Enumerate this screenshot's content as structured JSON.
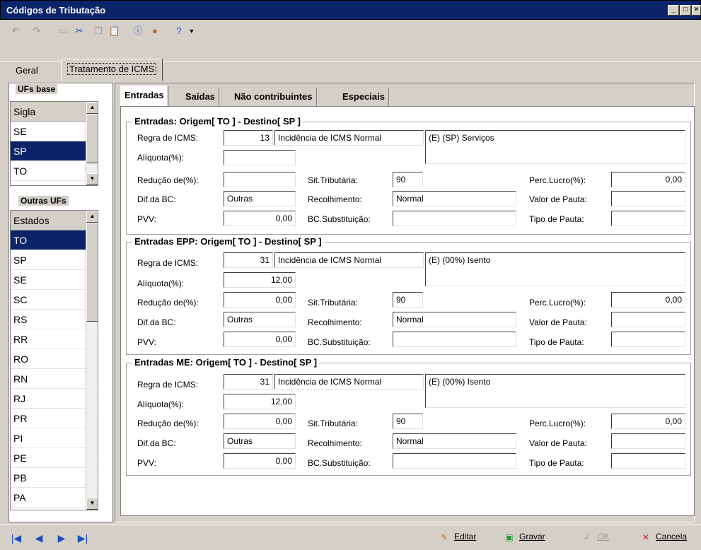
{
  "window": {
    "title": "Códigos de Tributação"
  },
  "toolbar": {
    "icons": [
      "undo-icon",
      "redo-icon",
      "new-icon",
      "cut-icon",
      "copy-icon",
      "paste-icon",
      "info-icon",
      "user-icon",
      "help-icon",
      "dropdown-arrow-icon"
    ]
  },
  "tabs": {
    "general": "Geral",
    "icms": "Tratamento de ICMS"
  },
  "ufs_base": {
    "title": "UFs base",
    "header": "Sigla",
    "items": [
      "SE",
      "SP",
      "TO"
    ],
    "selected": "SP"
  },
  "outras_ufs": {
    "title": "Outras UFs",
    "header": "Estados",
    "items": [
      "TO",
      "SP",
      "SE",
      "SC",
      "RS",
      "RR",
      "RO",
      "RN",
      "RJ",
      "PR",
      "PI",
      "PE",
      "PB",
      "PA"
    ],
    "selected": "TO"
  },
  "inner_tabs": [
    "Entradas",
    "Saídas",
    "Não contribuintes",
    "Especiais"
  ],
  "labels": {
    "regra": "Regra de ICMS:",
    "aliquota": "Alíquota(%):",
    "reducao": "Redução de(%):",
    "dif_bc": "Dif.da BC:",
    "pvv": "PVV:",
    "sit_trib": "Sit.Tributária:",
    "recolhimento": "Recolhimento:",
    "bc_subst": "BC.Substituição:",
    "perc_lucro": "Perc.Lucro(%):",
    "valor_pauta": "Valor de Pauta:",
    "tipo_pauta": "Tipo de Pauta:"
  },
  "sections": [
    {
      "title": "Entradas: Origem[ TO ] - Destino[ SP ]",
      "regra_code": "13",
      "regra_desc": "Incidência de ICMS Normal",
      "regra_note": "(E) (SP) Serviços",
      "aliquota": "",
      "reducao": "",
      "dif_bc": "Outras",
      "pvv": "0,00",
      "sit_trib": "90",
      "recolhimento": "Normal",
      "bc_subst": "",
      "perc_lucro": "0,00",
      "valor_pauta": "",
      "tipo_pauta": ""
    },
    {
      "title": "Entradas EPP: Origem[ TO ] - Destino[ SP ]",
      "regra_code": "31",
      "regra_desc": "Incidência de ICMS Normal",
      "regra_note": "(E) (00%) Isento",
      "aliquota": "12,00",
      "reducao": "0,00",
      "dif_bc": "Outras",
      "pvv": "0,00",
      "sit_trib": "90",
      "recolhimento": "Normal",
      "bc_subst": "",
      "perc_lucro": "0,00",
      "valor_pauta": "",
      "tipo_pauta": ""
    },
    {
      "title": "Entradas ME: Origem[ TO ] - Destino[ SP ]",
      "regra_code": "31",
      "regra_desc": "Incidência de ICMS Normal",
      "regra_note": "(E) (00%) Isento",
      "aliquota": "12,00",
      "reducao": "0,00",
      "dif_bc": "Outras",
      "pvv": "0,00",
      "sit_trib": "90",
      "recolhimento": "Normal",
      "bc_subst": "",
      "perc_lucro": "0,00",
      "valor_pauta": "",
      "tipo_pauta": ""
    }
  ],
  "actions": {
    "edit": "Editar",
    "save": "Gravar",
    "ok": "OK",
    "cancel": "Cancela"
  },
  "colors": {
    "selection": "#0a246a",
    "face": "#d4d0c8",
    "cancel": "#d0201a",
    "save": "#2f9a2f"
  }
}
